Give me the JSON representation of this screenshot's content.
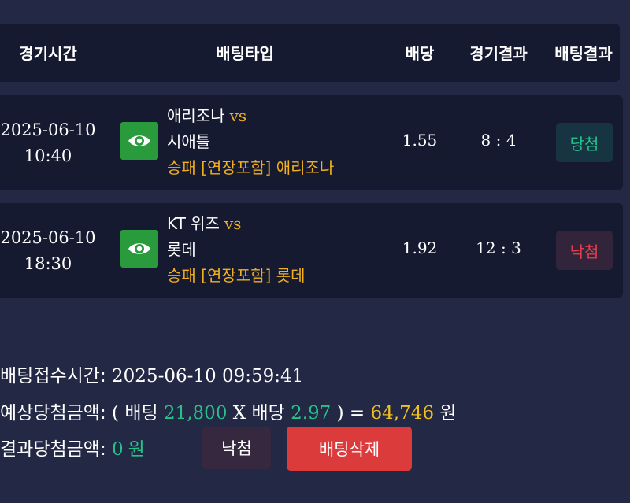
{
  "table_header": {
    "time": "경기시간",
    "bet_type": "배팅타입",
    "odds": "배당",
    "game_result": "경기결과",
    "bet_result": "배팅결과"
  },
  "bets": [
    {
      "date": "2025-06-10",
      "time": "10:40",
      "view_icon": "eye-icon",
      "home_team": "애리조나",
      "vs": "vs",
      "away_team": "시애틀",
      "pick": "승패 [연장포함] 애리조나",
      "odds": "1.55",
      "score": "8 : 4",
      "result": "당첨",
      "result_color": "#27c08a"
    },
    {
      "date": "2025-06-10",
      "time": "18:30",
      "view_icon": "eye-icon",
      "home_team": "KT 위즈",
      "vs": "vs",
      "away_team": "롯데",
      "pick": "승패 [연장포함] 롯데",
      "odds": "1.92",
      "score": "12 : 3",
      "result": "낙첨",
      "result_color": "#e03e4a"
    }
  ],
  "summary": {
    "received_label": "배팅접수시간:",
    "received_value": "2025-06-10 09:59:41",
    "expected_label": "예상당첨금액:",
    "open_paren": "(",
    "bet_label": "배팅",
    "bet_amount": "21,800",
    "times": "X",
    "odds_label": "배당",
    "total_odds": "2.97",
    "close_eq": ") =",
    "expected_amount": "64,746",
    "won": "원",
    "result_label": "결과당첨금액:",
    "result_amount": "0",
    "result_won": "원"
  },
  "buttons": {
    "lose": "낙첨",
    "delete": "배팅삭제"
  },
  "colors": {
    "background": "#232844",
    "row_background": "#151a30",
    "accent_green": "#27c08a",
    "accent_gold": "#f0c020",
    "delete_red": "#dc3b3c"
  }
}
